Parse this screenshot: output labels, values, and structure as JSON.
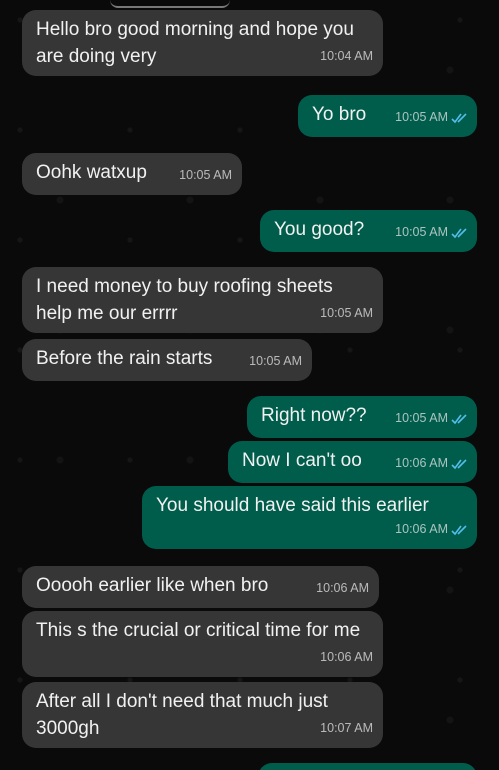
{
  "conversation": {
    "messages": [
      {
        "id": "m1",
        "direction": "in",
        "text": "Hello bro good morning and hope you are doing very",
        "time": "10:04 AM"
      },
      {
        "id": "m2",
        "direction": "out",
        "text": "Yo bro",
        "time": "10:05 AM",
        "read_receipt": "double-check-icon"
      },
      {
        "id": "m3",
        "direction": "in",
        "text": "Oohk watxup",
        "time": "10:05 AM"
      },
      {
        "id": "m4",
        "direction": "out",
        "text": "You good?",
        "time": "10:05 AM",
        "read_receipt": "double-check-icon"
      },
      {
        "id": "m5",
        "direction": "in",
        "text": "I need money to buy roofing sheets help me our errrr",
        "time": "10:05 AM"
      },
      {
        "id": "m6",
        "direction": "in",
        "text": "Before the rain starts",
        "time": "10:05 AM"
      },
      {
        "id": "m7",
        "direction": "out",
        "text": "Right now??",
        "time": "10:05 AM",
        "read_receipt": "double-check-icon"
      },
      {
        "id": "m8",
        "direction": "out",
        "text": "Now I can't oo",
        "time": "10:06 AM",
        "read_receipt": "double-check-icon"
      },
      {
        "id": "m9",
        "direction": "out",
        "text": "You should have said this earlier",
        "time": "10:06 AM",
        "read_receipt": "double-check-icon"
      },
      {
        "id": "m10",
        "direction": "in",
        "text": "Ooooh earlier like when bro",
        "time": "10:06 AM"
      },
      {
        "id": "m11",
        "direction": "in",
        "text": "This s the crucial or critical time for me",
        "time": "10:06 AM"
      },
      {
        "id": "m12",
        "direction": "in",
        "text": "After all I don't need that much just 3000gh",
        "time": "10:07 AM"
      }
    ]
  },
  "colors": {
    "incoming_bubble": "#363636",
    "outgoing_bubble": "#005c4b",
    "read_tick": "#53bdeb",
    "background": "#0a0a0a"
  }
}
